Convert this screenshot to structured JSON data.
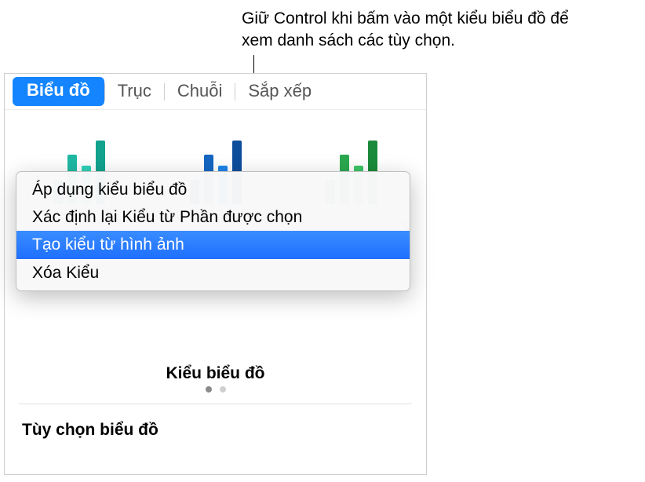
{
  "callout": {
    "text": "Giữ Control khi bấm vào một kiểu biểu đồ để xem danh sách các tùy chọn."
  },
  "tabs": {
    "chart": "Biểu đồ",
    "axis": "Trục",
    "series": "Chuỗi",
    "arrange": "Sắp xếp"
  },
  "context_menu": {
    "items": [
      "Áp dụng kiểu biểu đồ",
      "Xác định lại Kiểu từ Phần được chọn",
      "Tạo kiểu từ hình ảnh",
      "Xóa Kiểu"
    ]
  },
  "sections": {
    "style_title": "Kiểu biểu đồ",
    "options_title": "Tùy chọn biểu đồ"
  },
  "colors": {
    "accent": "#1485ff",
    "teal1": "#12a38e",
    "teal2": "#1fb8a3",
    "teal3": "#2ed1b8",
    "blue1": "#0d4d9c",
    "blue2": "#1466c2",
    "blue3": "#1e84e8",
    "green1": "#1b8a3a",
    "green2": "#2aa84f",
    "green3": "#3cc465"
  }
}
